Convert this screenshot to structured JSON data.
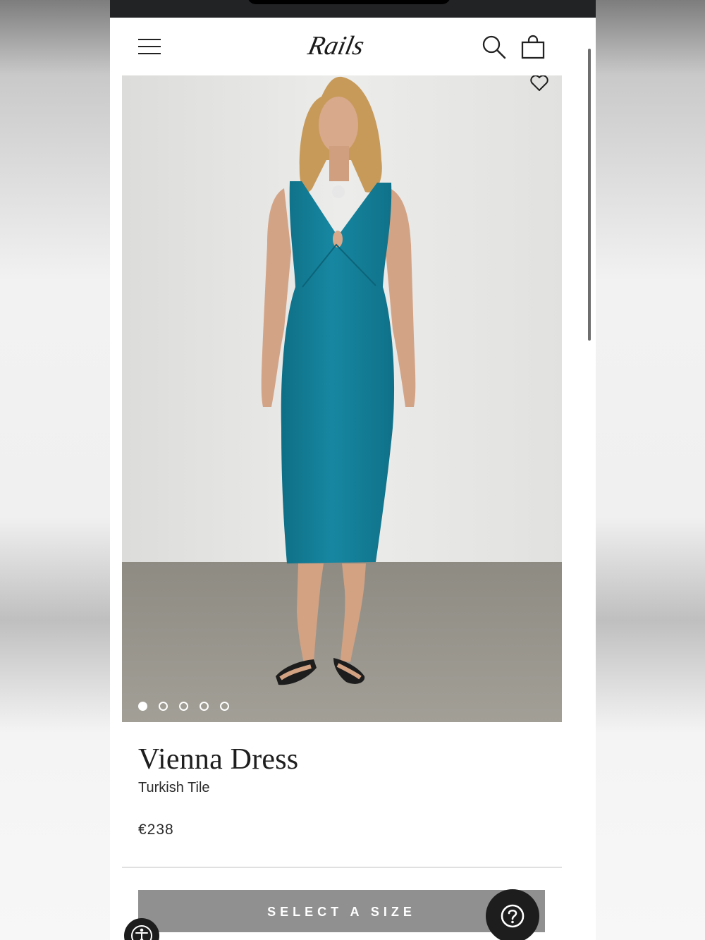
{
  "header": {
    "logo_text": "Rails"
  },
  "product": {
    "title": "Vienna Dress",
    "color_name": "Turkish Tile",
    "price": "€238",
    "image_count": 5,
    "active_image_index": 1,
    "dress_color": "#137e98"
  },
  "actions": {
    "select_size_label": "SELECT A SIZE"
  },
  "icons": {
    "menu": "hamburger-menu-icon",
    "search": "search-icon",
    "bag": "shopping-bag-icon",
    "wishlist": "heart-icon",
    "help": "question-mark-icon",
    "accessibility": "accessibility-icon"
  }
}
